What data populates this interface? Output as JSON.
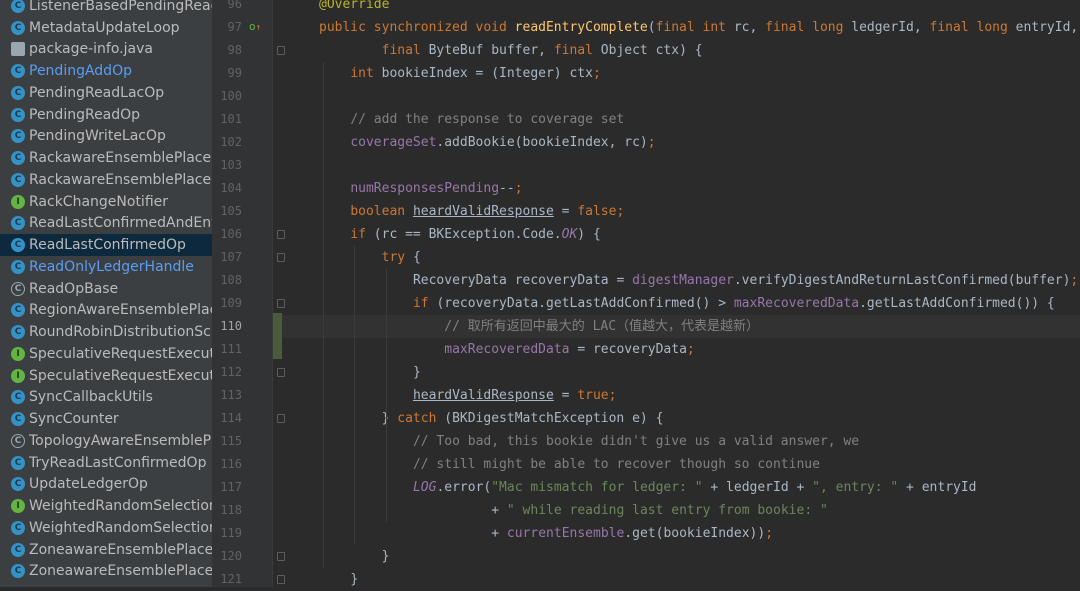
{
  "sidebar": {
    "items": [
      {
        "label": "ListenerBasedPendingReadOp",
        "icon": "class-icon",
        "color": "#bbbbbb"
      },
      {
        "label": "MetadataUpdateLoop",
        "icon": "class-icon",
        "color": "#bbbbbb"
      },
      {
        "label": "package-info.java",
        "icon": "java-file-icon",
        "color": "#bbbbbb"
      },
      {
        "label": "PendingAddOp",
        "icon": "class-icon",
        "color": "#589df6"
      },
      {
        "label": "PendingReadLacOp",
        "icon": "class-icon",
        "color": "#bbbbbb"
      },
      {
        "label": "PendingReadOp",
        "icon": "class-icon",
        "color": "#bbbbbb"
      },
      {
        "label": "PendingWriteLacOp",
        "icon": "class-icon",
        "color": "#bbbbbb"
      },
      {
        "label": "RackawareEnsemblePlacementPolicy",
        "icon": "class-icon",
        "color": "#bbbbbb"
      },
      {
        "label": "RackawareEnsemblePlacementPolicyImpl",
        "icon": "class-icon",
        "color": "#bbbbbb"
      },
      {
        "label": "RackChangeNotifier",
        "icon": "interface-icon",
        "color": "#bbbbbb"
      },
      {
        "label": "ReadLastConfirmedAndEntryOp",
        "icon": "class-icon",
        "color": "#bbbbbb"
      },
      {
        "label": "ReadLastConfirmedOp",
        "icon": "class-icon",
        "color": "#bbbbbb",
        "selected": true
      },
      {
        "label": "ReadOnlyLedgerHandle",
        "icon": "class-icon",
        "color": "#589df6"
      },
      {
        "label": "ReadOpBase",
        "icon": "abstract-class-icon",
        "color": "#bbbbbb"
      },
      {
        "label": "RegionAwareEnsemblePlacementPolicy",
        "icon": "class-icon",
        "color": "#bbbbbb"
      },
      {
        "label": "RoundRobinDistributionSchedule",
        "icon": "class-icon",
        "color": "#bbbbbb"
      },
      {
        "label": "SpeculativeRequestExecutionPolicy",
        "icon": "interface-icon",
        "color": "#bbbbbb"
      },
      {
        "label": "SpeculativeRequestExecutor",
        "icon": "interface-icon",
        "color": "#bbbbbb"
      },
      {
        "label": "SyncCallbackUtils",
        "icon": "class-icon",
        "color": "#bbbbbb"
      },
      {
        "label": "SyncCounter",
        "icon": "class-icon",
        "color": "#bbbbbb"
      },
      {
        "label": "TopologyAwareEnsemblePlacementPolicy",
        "icon": "abstract-class-icon",
        "color": "#bbbbbb"
      },
      {
        "label": "TryReadLastConfirmedOp",
        "icon": "class-icon",
        "color": "#bbbbbb"
      },
      {
        "label": "UpdateLedgerOp",
        "icon": "class-icon",
        "color": "#bbbbbb"
      },
      {
        "label": "WeightedRandomSelection",
        "icon": "interface-icon",
        "color": "#bbbbbb"
      },
      {
        "label": "WeightedRandomSelectionImpl",
        "icon": "class-icon",
        "color": "#bbbbbb"
      },
      {
        "label": "ZoneawareEnsemblePlacementPolicy",
        "icon": "class-icon",
        "color": "#bbbbbb"
      },
      {
        "label": "ZoneawareEnsemblePlacementPolicyImpl",
        "icon": "class-icon",
        "color": "#bbbbbb"
      }
    ]
  },
  "editor": {
    "current_line": 110,
    "lines": [
      {
        "n": 96,
        "indent": 0,
        "tokens": [
          [
            "@Override",
            "ann"
          ]
        ]
      },
      {
        "n": 97,
        "indent": 0,
        "tokens": [
          [
            "public synchronized void ",
            "kw"
          ],
          [
            "readEntryComplete",
            "fn"
          ],
          [
            "(",
            ""
          ],
          [
            "final int ",
            "kw"
          ],
          [
            "rc, ",
            ""
          ],
          [
            "final long ",
            "kw"
          ],
          [
            "ledgerId, ",
            ""
          ],
          [
            "final long ",
            "kw"
          ],
          [
            "entryId,",
            ""
          ]
        ]
      },
      {
        "n": 98,
        "indent": 2,
        "tokens": [
          [
            "final ",
            "kw"
          ],
          [
            "ByteBuf buffer, ",
            ""
          ],
          [
            "final ",
            "kw"
          ],
          [
            "Object ctx) {",
            ""
          ]
        ]
      },
      {
        "n": 99,
        "indent": 1,
        "tokens": [
          [
            "int ",
            "kw"
          ],
          [
            "bookieIndex = (Integer) ctx",
            ""
          ],
          [
            ";",
            "kw"
          ]
        ]
      },
      {
        "n": 100,
        "indent": 0,
        "tokens": []
      },
      {
        "n": 101,
        "indent": 1,
        "tokens": [
          [
            "// add the response to coverage set",
            "cm"
          ]
        ]
      },
      {
        "n": 102,
        "indent": 1,
        "tokens": [
          [
            "coverageSet",
            "fld"
          ],
          [
            ".addBookie(bookieIndex, rc)",
            ""
          ],
          [
            ";",
            "kw"
          ]
        ]
      },
      {
        "n": 103,
        "indent": 0,
        "tokens": []
      },
      {
        "n": 104,
        "indent": 1,
        "tokens": [
          [
            "numResponsesPending",
            "fld"
          ],
          [
            "--",
            ""
          ],
          [
            ";",
            "kw"
          ]
        ]
      },
      {
        "n": 105,
        "indent": 1,
        "tokens": [
          [
            "boolean ",
            "kw"
          ],
          [
            "heardValidResponse",
            "und"
          ],
          [
            " = ",
            ""
          ],
          [
            "false",
            "kw"
          ],
          [
            ";",
            "kw"
          ]
        ]
      },
      {
        "n": 106,
        "indent": 1,
        "tokens": [
          [
            "if ",
            "kw"
          ],
          [
            "(rc == BKException.Code.",
            ""
          ],
          [
            "OK",
            "fld ital"
          ],
          [
            ") {",
            ""
          ]
        ]
      },
      {
        "n": 107,
        "indent": 2,
        "tokens": [
          [
            "try ",
            "kw"
          ],
          [
            "{",
            ""
          ]
        ]
      },
      {
        "n": 108,
        "indent": 3,
        "tokens": [
          [
            "RecoveryData recoveryData = ",
            ""
          ],
          [
            "digestManager",
            "fld"
          ],
          [
            ".verifyDigestAndReturnLastConfirmed(buffer)",
            ""
          ],
          [
            ";",
            "kw"
          ]
        ]
      },
      {
        "n": 109,
        "indent": 3,
        "tokens": [
          [
            "if ",
            "kw"
          ],
          [
            "(recoveryData.getLastAddConfirmed() > ",
            ""
          ],
          [
            "maxRecoveredData",
            "fld"
          ],
          [
            ".getLastAddConfirmed()) {",
            ""
          ]
        ]
      },
      {
        "n": 110,
        "indent": 4,
        "tokens": [
          [
            "// 取所有返回中最大的 LAC（值越大，代表是越新）",
            "cm"
          ]
        ]
      },
      {
        "n": 111,
        "indent": 4,
        "tokens": [
          [
            "maxRecoveredData",
            "fld"
          ],
          [
            " = recoveryData",
            ""
          ],
          [
            ";",
            "kw"
          ]
        ]
      },
      {
        "n": 112,
        "indent": 3,
        "tokens": [
          [
            "}",
            ""
          ]
        ]
      },
      {
        "n": 113,
        "indent": 3,
        "tokens": [
          [
            "heardValidResponse",
            "und"
          ],
          [
            " = ",
            ""
          ],
          [
            "true",
            "kw"
          ],
          [
            ";",
            "kw"
          ]
        ]
      },
      {
        "n": 114,
        "indent": 2,
        "tokens": [
          [
            "} ",
            ""
          ],
          [
            "catch ",
            "kw"
          ],
          [
            "(BKDigestMatchException e) {",
            ""
          ]
        ]
      },
      {
        "n": 115,
        "indent": 3,
        "tokens": [
          [
            "// Too bad, this bookie didn't give us a valid answer, we",
            "cm"
          ]
        ]
      },
      {
        "n": 116,
        "indent": 3,
        "tokens": [
          [
            "// still might be able to recover though so continue",
            "cm"
          ]
        ]
      },
      {
        "n": 117,
        "indent": 3,
        "tokens": [
          [
            "LOG",
            "fld ital"
          ],
          [
            ".error(",
            ""
          ],
          [
            "\"Mac mismatch for ledger: \"",
            "str"
          ],
          [
            " + ledgerId + ",
            ""
          ],
          [
            "\", entry: \"",
            "str"
          ],
          [
            " + entryId",
            ""
          ]
        ]
      },
      {
        "n": 118,
        "indent": 5.5,
        "tokens": [
          [
            "+ ",
            ""
          ],
          [
            "\" while reading last entry from bookie: \"",
            "str"
          ]
        ]
      },
      {
        "n": 119,
        "indent": 5.5,
        "tokens": [
          [
            "+ ",
            ""
          ],
          [
            "currentEnsemble",
            "fld"
          ],
          [
            ".get(bookieIndex))",
            ""
          ],
          [
            ";",
            "kw"
          ]
        ]
      },
      {
        "n": 120,
        "indent": 2,
        "tokens": [
          [
            "}",
            ""
          ]
        ]
      },
      {
        "n": 121,
        "indent": 1,
        "tokens": [
          [
            "}",
            ""
          ]
        ]
      }
    ]
  }
}
